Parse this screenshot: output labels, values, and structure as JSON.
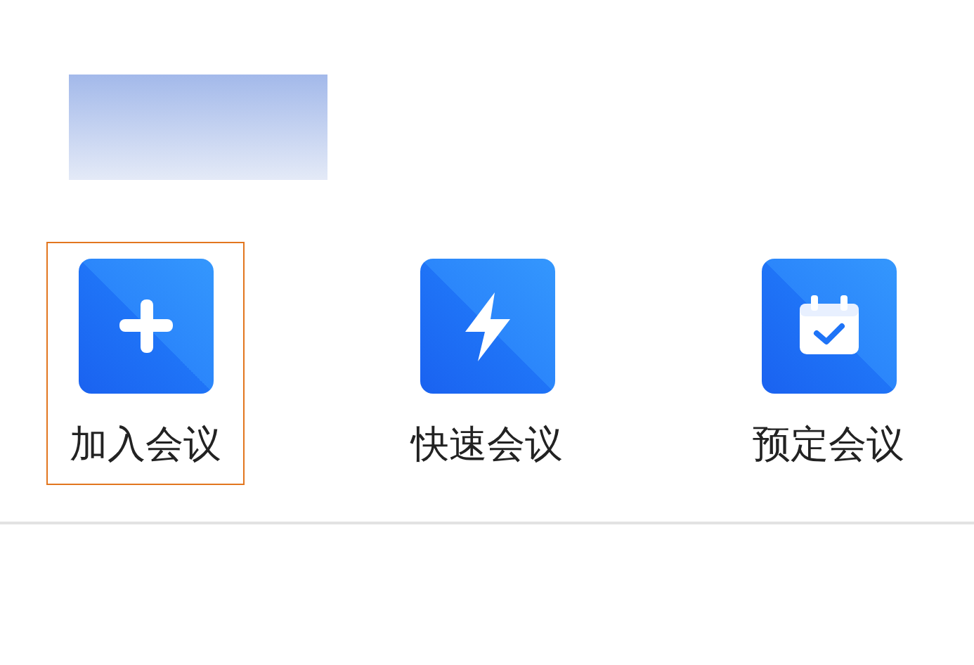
{
  "actions": [
    {
      "label": "加入会议",
      "selected": true
    },
    {
      "label": "快速会议",
      "selected": false
    },
    {
      "label": "预定会议",
      "selected": false
    }
  ]
}
